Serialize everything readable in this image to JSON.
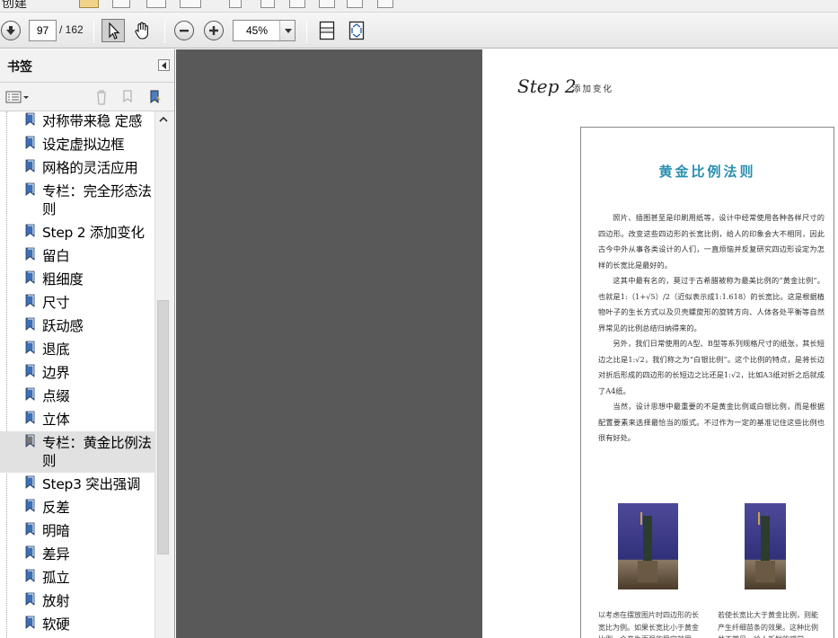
{
  "menu": {
    "partial_label": "创建"
  },
  "toolbar": {
    "current_page": "97",
    "page_total": "/ 162",
    "zoom": "45%",
    "icons": [
      "prev-page-icon",
      "select-tool-icon",
      "hand-tool-icon",
      "zoom-out-icon",
      "zoom-in-icon",
      "fit-page-icon",
      "fit-width-icon"
    ]
  },
  "sidebar": {
    "title": "书签",
    "bookmarks": [
      {
        "label": "对称带来稳 定感"
      },
      {
        "label": "设定虚拟边框"
      },
      {
        "label": "网格的灵活应用"
      },
      {
        "label": "专栏：完全形态法则"
      },
      {
        "label": "Step 2 添加变化"
      },
      {
        "label": "留白"
      },
      {
        "label": "粗细度"
      },
      {
        "label": "尺寸"
      },
      {
        "label": "跃动感"
      },
      {
        "label": "退底"
      },
      {
        "label": "边界"
      },
      {
        "label": "点缀"
      },
      {
        "label": "立体"
      },
      {
        "label": "专栏：黄金比例法则",
        "selected": true
      },
      {
        "label": "Step3 突出强调"
      },
      {
        "label": "反差"
      },
      {
        "label": "明暗"
      },
      {
        "label": "差异"
      },
      {
        "label": "孤立"
      },
      {
        "label": "放射"
      },
      {
        "label": "软硬"
      }
    ]
  },
  "document": {
    "step_label": "Step 2",
    "step_subtitle": "添加变化",
    "article_title": "黄金比例法则",
    "paragraphs": [
      "照片、插图甚至是印刷用纸等，设计中经常使用各种各样尺寸的四边形。改变这些四边形的长宽比例，给人的印象会大不相同，因此古今中外从事各类设计的人们，一直烦恼并反复研究四边形设定为怎样的长宽比是最好的。",
      "这其中最有名的，莫过于古希腊被称为最美比例的“黄金比例”。也就是1:（1+√5）/2（近似表示成1:1.618）的长宽比。这是根据植物叶子的生长方式以及贝壳螺旋形的旋转方向、人体各处平衡等自然界常见的比例总结归纳得来的。",
      "另外，我们日常使用的A型、B型等系列规格尺寸的纸张，其长短边之比是1:√2，我们称之为“白银比例”。这个比例的特点，是将长边对折后形成的四边形的长短边之比还是1:√2，比如A3纸对折之后就成了A4纸。",
      "当然，设计思想中最重要的不是黄金比例或白银比例，而是根据配置要素来选择最恰当的版式。不过作为一定的基准记住这些比例也很有好处。"
    ],
    "caption_left": "以考虑在摆放图片时四边形的长宽比为例。如果长宽比小于黄金比例，会产生更强的稳定效果。",
    "caption_right": "若使长宽比大于黄金比例，则能产生纤细苗条的效果。这种比例并不常见，给人新鲜的感觉。"
  },
  "colors": {
    "viewer_bg": "#595959",
    "title_accent": "#2a8fb0",
    "selected_bg": "#e1e1e1"
  }
}
